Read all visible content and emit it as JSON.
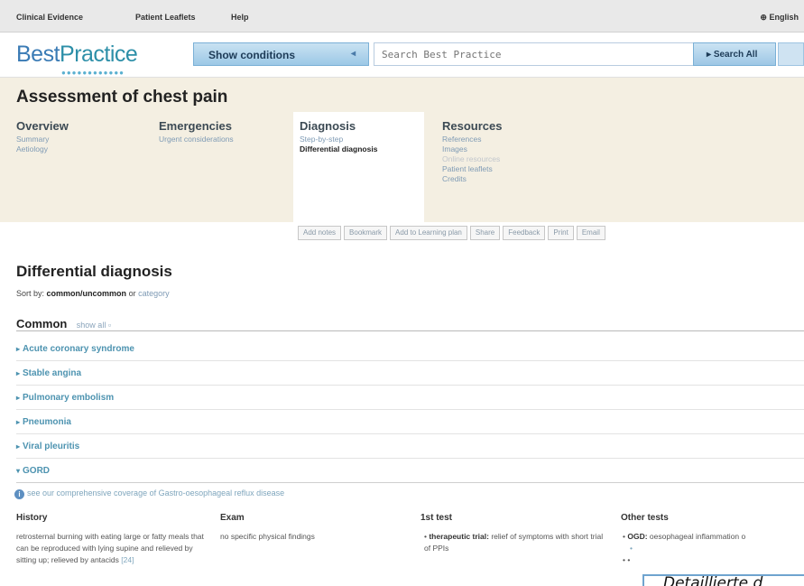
{
  "topbar": {
    "links": [
      "Clinical Evidence",
      "Patient Leaflets",
      "Help"
    ],
    "language": "English"
  },
  "header": {
    "logo": "BestPractice",
    "logo_part1": "Best",
    "logo_part2": "Practice",
    "show_conditions": "Show conditions",
    "search_placeholder": "Search Best Practice",
    "search_button": "Search All"
  },
  "page": {
    "title": "Assessment of chest pain"
  },
  "nav": {
    "overview": {
      "label": "Overview",
      "items": [
        "Summary",
        "Aetiology"
      ]
    },
    "emergencies": {
      "label": "Emergencies",
      "items": [
        "Urgent considerations"
      ]
    },
    "diagnosis": {
      "label": "Diagnosis",
      "items": [
        "Step-by-step",
        "Differential diagnosis"
      ]
    },
    "resources": {
      "label": "Resources",
      "items": [
        "References",
        "Images",
        "Online resources",
        "Patient leaflets",
        "Credits"
      ]
    }
  },
  "toolbar": [
    "Add notes",
    "Bookmark",
    "Add to Learning plan",
    "Share",
    "Feedback",
    "Print",
    "Email"
  ],
  "content": {
    "title": "Differential diagnosis",
    "sort_label": "Sort by:",
    "sort_current": "common/uncommon",
    "sort_or": "or",
    "sort_alt": "category",
    "section": "Common",
    "show_all": "show all",
    "conditions": [
      "Acute coronary syndrome",
      "Stable angina",
      "Pulmonary embolism",
      "Pneumonia",
      "Viral pleuritis",
      "GORD"
    ],
    "note": "see our comprehensive coverage of Gastro-oesophageal reflux disease",
    "columns": [
      "History",
      "Exam",
      "1st test",
      "Other tests"
    ],
    "history": "retrosternal burning with eating large or fatty meals that can be reproduced with lying supine and relieved by sitting up; relieved by antacids",
    "history_ref": "[24]",
    "exam": "no specific physical findings",
    "first_test_label": "therapeutic trial:",
    "first_test": "relief of symptoms with short trial of PPIs",
    "other_test_label": "OGD:",
    "other_test": "oesophageal inflammation o"
  },
  "overlay": {
    "text": "Detaillierte d"
  }
}
